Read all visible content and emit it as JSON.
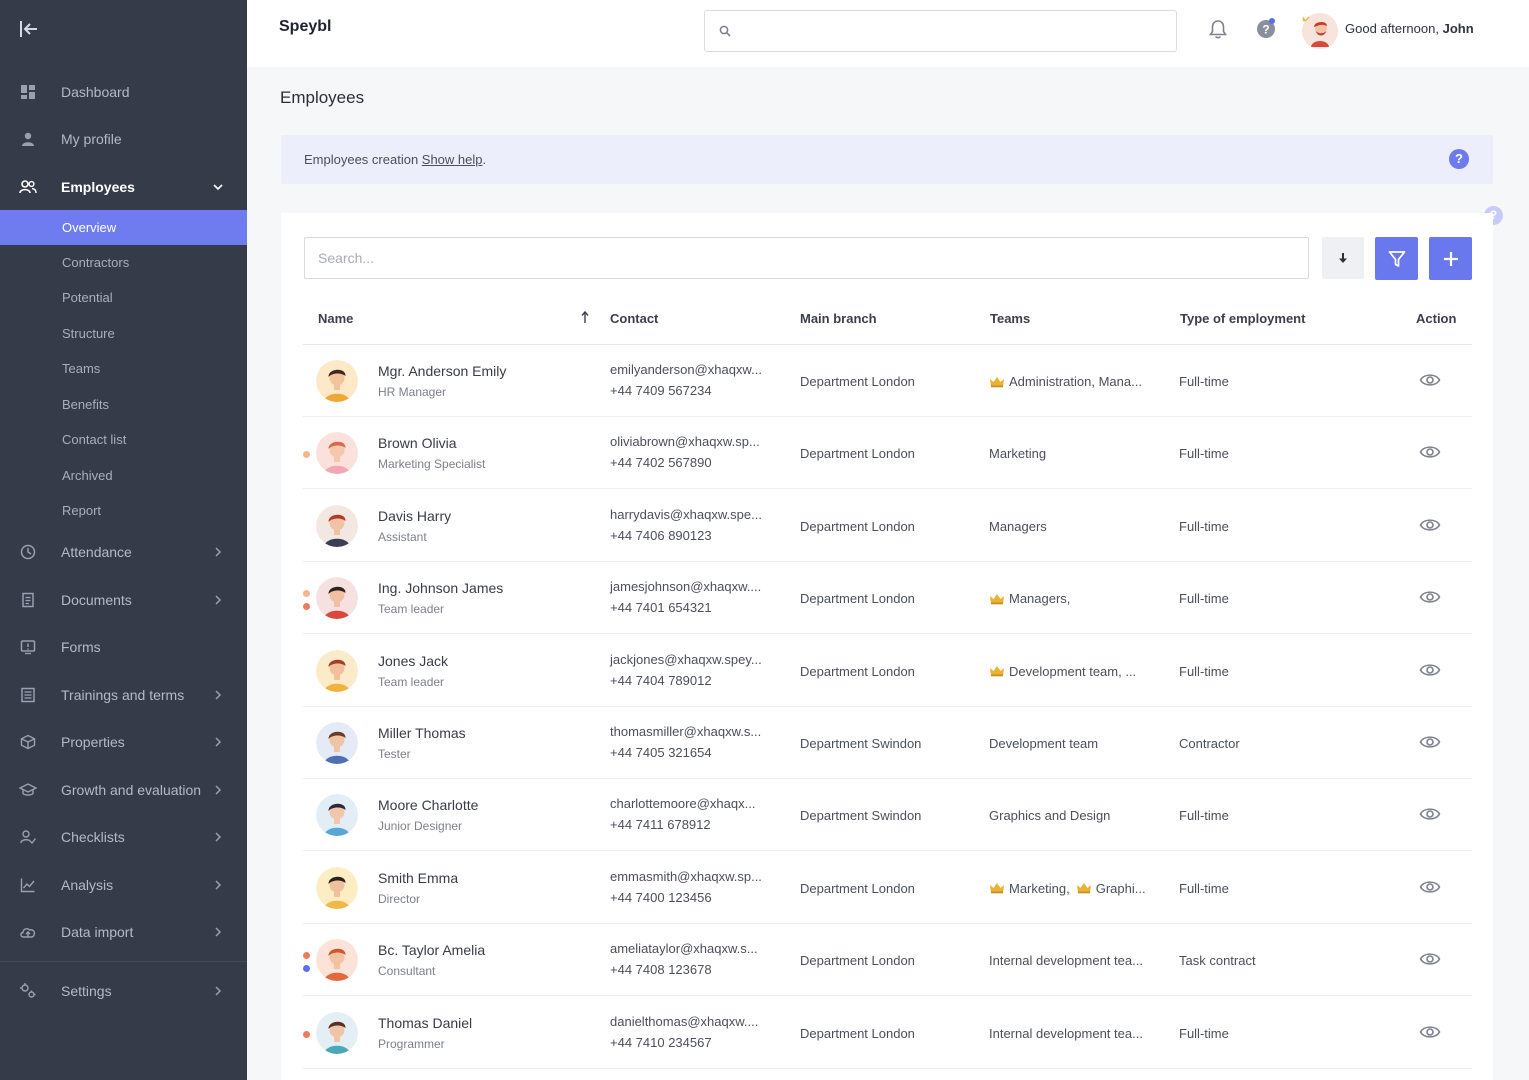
{
  "app": {
    "brand": "Speybl"
  },
  "colors": {
    "accent": "#6a78ee",
    "sidebar": "#363b4a"
  },
  "header": {
    "search_placeholder": "",
    "greeting_prefix": "Good afternoon,",
    "user_name": "John"
  },
  "sidebar": {
    "items": [
      {
        "label": "Dashboard",
        "icon": "dashboard-icon"
      },
      {
        "label": "My profile",
        "icon": "user-icon"
      },
      {
        "label": "Employees",
        "icon": "users-icon"
      },
      {
        "label": "Attendance",
        "icon": "clock-icon"
      },
      {
        "label": "Documents",
        "icon": "document-icon"
      },
      {
        "label": "Forms",
        "icon": "form-icon"
      },
      {
        "label": "Trainings and terms",
        "icon": "training-icon"
      },
      {
        "label": "Properties",
        "icon": "box-icon"
      },
      {
        "label": "Growth and evaluation",
        "icon": "graduation-icon"
      },
      {
        "label": "Checklists",
        "icon": "checklist-icon"
      },
      {
        "label": "Analysis",
        "icon": "chart-icon"
      },
      {
        "label": "Data import",
        "icon": "cloud-upload-icon"
      },
      {
        "label": "Settings",
        "icon": "settings-icon"
      }
    ],
    "employees_sub": [
      "Overview",
      "Contractors",
      "Potential",
      "Structure",
      "Teams",
      "Benefits",
      "Contact list",
      "Archived",
      "Report"
    ]
  },
  "page": {
    "title": "Employees",
    "banner_text": "Employees creation ",
    "banner_link": "Show help",
    "banner_suffix": ".",
    "help_glyph": "?"
  },
  "table": {
    "search_placeholder": "Search...",
    "columns": {
      "name": "Name",
      "contact": "Contact",
      "branch": "Main branch",
      "teams": "Teams",
      "type": "Type of employment",
      "action": "Action"
    },
    "rows": [
      {
        "name": "Mgr. Anderson Emily",
        "position": "HR Manager",
        "email": "emilyanderson@xhaqxw...",
        "phone": "+44 7409 567234",
        "branch": "Department London",
        "teams": "Administration, Mana...",
        "team_crown": true,
        "type": "Full-time",
        "dots": []
      },
      {
        "name": "Brown Olivia",
        "position": "Marketing Specialist",
        "email": "oliviabrown@xhaqxw.sp...",
        "phone": "+44 7402 567890",
        "branch": "Department London",
        "teams": "Marketing",
        "team_crown": false,
        "type": "Full-time",
        "dots": [
          "#f2b78f"
        ]
      },
      {
        "name": "Davis Harry",
        "position": "Assistant",
        "email": "harrydavis@xhaqxw.spe...",
        "phone": "+44 7406 890123",
        "branch": "Department London",
        "teams": "Managers",
        "team_crown": false,
        "type": "Full-time",
        "dots": []
      },
      {
        "name": "Ing. Johnson James",
        "position": "Team leader",
        "email": "jamesjohnson@xhaqxw....",
        "phone": "+44 7401 654321",
        "branch": "Department London",
        "teams": "Managers,",
        "team_crown": true,
        "type": "Full-time",
        "dots": [
          "#f2b78f",
          "#ee7b5a"
        ]
      },
      {
        "name": "Jones Jack",
        "position": "Team leader",
        "email": "jackjones@xhaqxw.spey...",
        "phone": "+44 7404 789012",
        "branch": "Department London",
        "teams": "Development team, ...",
        "team_crown": true,
        "type": "Full-time",
        "dots": []
      },
      {
        "name": "Miller Thomas",
        "position": "Tester",
        "email": "thomasmiller@xhaqxw.s...",
        "phone": "+44 7405 321654",
        "branch": "Department Swindon",
        "teams": "Development team",
        "team_crown": false,
        "type": "Contractor",
        "dots": []
      },
      {
        "name": "Moore Charlotte",
        "position": "Junior Designer",
        "email": "charlottemoore@xhaqx...",
        "phone": "+44 7411 678912",
        "branch": "Department Swindon",
        "teams": "Graphics and Design",
        "team_crown": false,
        "type": "Full-time",
        "dots": []
      },
      {
        "name": "Smith Emma",
        "position": "Director",
        "email": "emmasmith@xhaqxw.sp...",
        "phone": "+44 7400 123456",
        "branch": "Department London",
        "teams": "Marketing,",
        "teams2": "Graphi...",
        "team_crown": true,
        "type": "Full-time",
        "dots": []
      },
      {
        "name": "Bc. Taylor Amelia",
        "position": "Consultant",
        "email": "ameliataylor@xhaqxw.s...",
        "phone": "+44 7408 123678",
        "branch": "Department London",
        "teams": "Internal development tea...",
        "team_crown": false,
        "type": "Task contract",
        "dots": [
          "#ee7b5a",
          "#5c6fe8"
        ]
      },
      {
        "name": "Thomas Daniel",
        "position": "Programmer",
        "email": "danielthomas@xhaqxw....",
        "phone": "+44 7410 234567",
        "branch": "Department London",
        "teams": "Internal development tea...",
        "team_crown": false,
        "type": "Full-time",
        "dots": [
          "#ee7b5a"
        ]
      }
    ]
  }
}
